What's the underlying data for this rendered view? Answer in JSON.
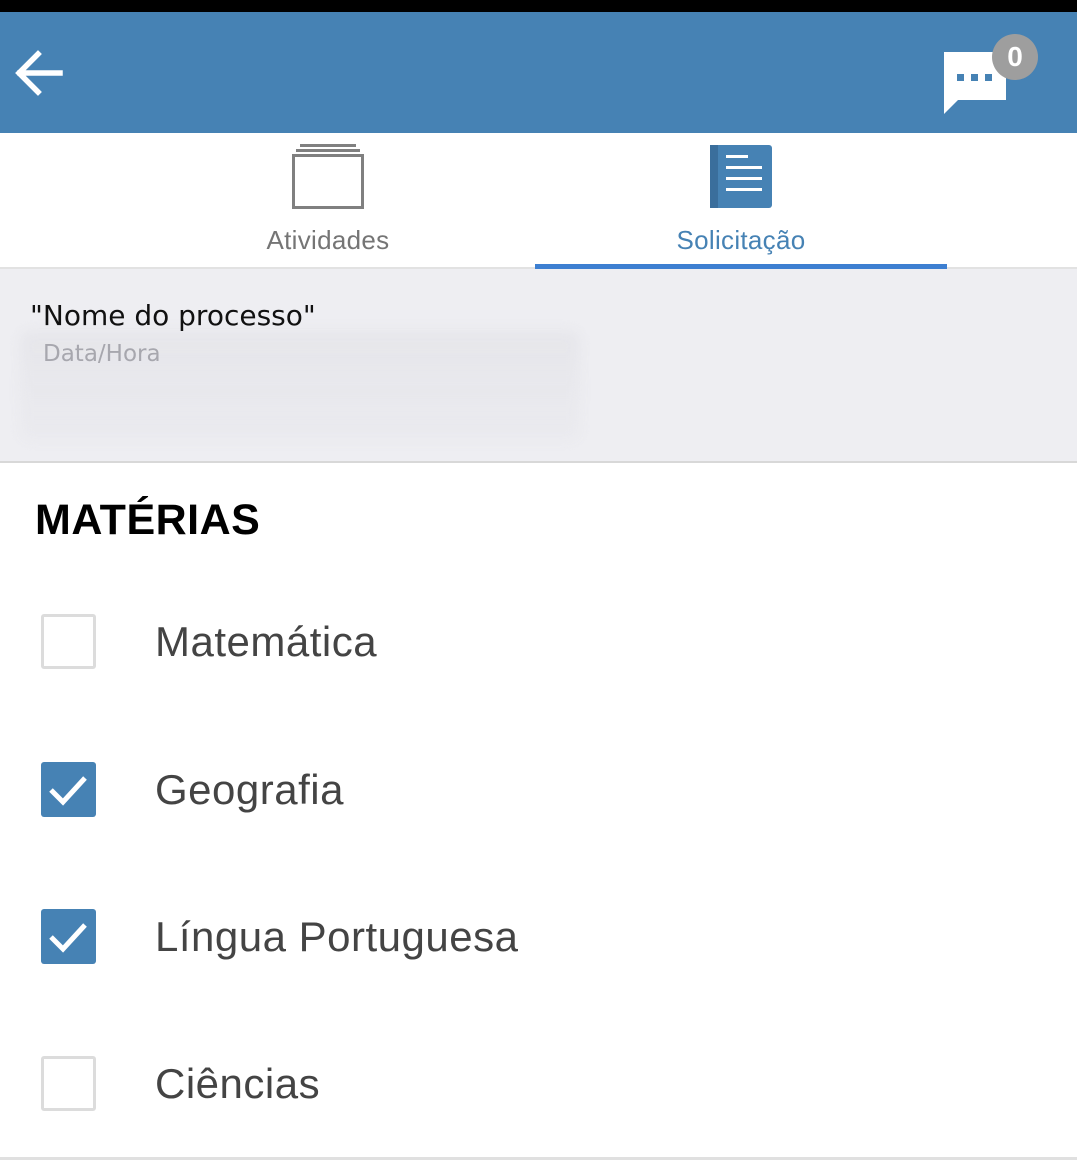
{
  "header": {
    "back_icon": "arrow-left-icon",
    "chat_icon": "chat-bubble-icon",
    "chat_badge": "0",
    "colors": {
      "appbar": "#4682b4",
      "badge": "#9e9e9e"
    }
  },
  "tabs": [
    {
      "label": "Atividades",
      "icon": "stacked-cards-icon",
      "active": false
    },
    {
      "label": "Solicitação",
      "icon": "document-icon",
      "active": true
    }
  ],
  "process": {
    "name": "\"Nome do processo\"",
    "datetime": "Data/Hora"
  },
  "section": {
    "title": "MATÉRIAS"
  },
  "options": [
    {
      "label": "Matemática",
      "checked": false
    },
    {
      "label": "Geografia",
      "checked": true
    },
    {
      "label": "Língua Portuguesa",
      "checked": true
    },
    {
      "label": "Ciências",
      "checked": false
    }
  ]
}
